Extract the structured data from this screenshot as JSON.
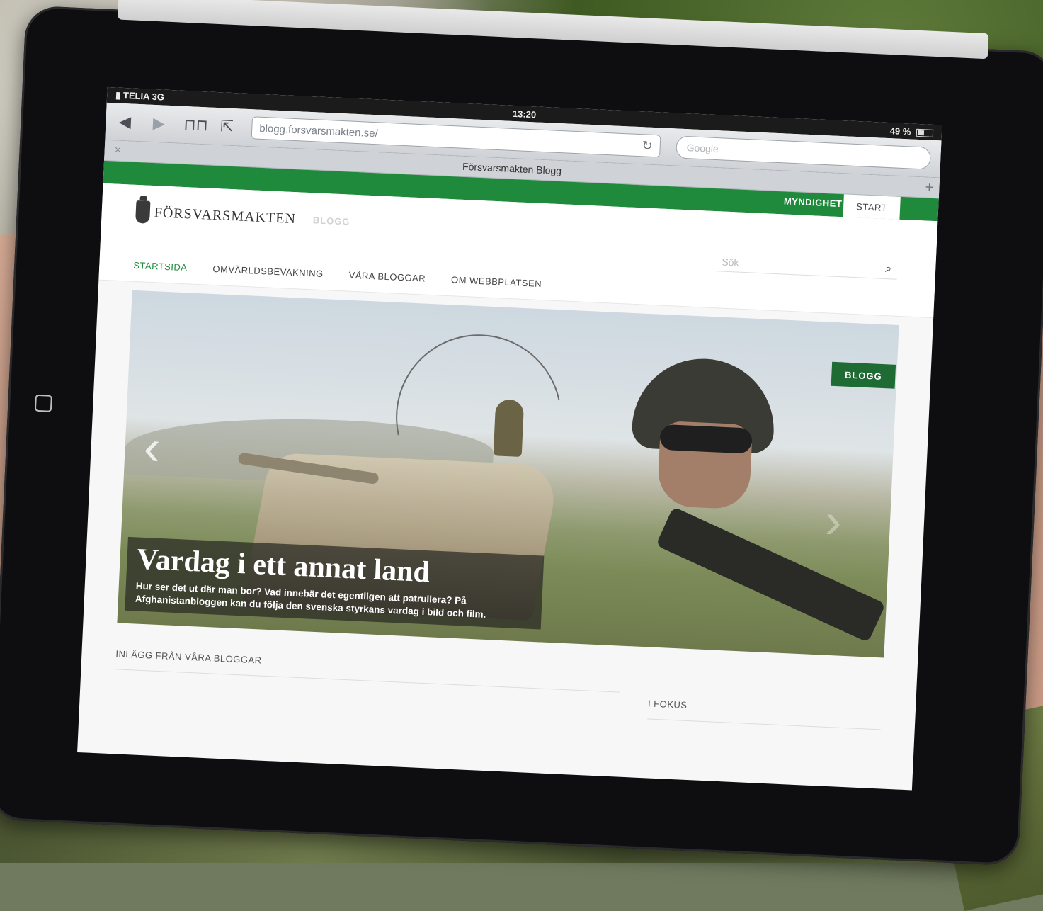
{
  "status_bar": {
    "carrier": "TELIA",
    "network": "3G",
    "time": "13:20",
    "battery": "49 %"
  },
  "safari": {
    "url": "blogg.forsvarsmakten.se/",
    "search_placeholder": "Google",
    "tab_title": "Försvarsmakten Blogg",
    "tab_close": "×",
    "tab_new": "+"
  },
  "site": {
    "topbar": {
      "myndighet": "MYNDIGHET",
      "start": "START"
    },
    "logo": {
      "name": "FÖRSVARSMAKTEN",
      "sub": "BLOGG"
    },
    "search_placeholder": "Sök",
    "nav": [
      {
        "label": "STARTSIDA",
        "active": true
      },
      {
        "label": "OMVÄRLDSBEVAKNING"
      },
      {
        "label": "VÅRA BLOGGAR"
      },
      {
        "label": "OM WEBBPLATSEN"
      }
    ],
    "hero": {
      "badge": "BLOGG",
      "title": "Vardag i ett annat land",
      "text": "Hur ser det ut där man bor? Vad innebär det egentligen att patrullera? På Afghanistanbloggen kan du följa den svenska styrkans vardag i bild och film."
    },
    "sections": {
      "posts": "INLÄGG FRÅN VÅRA BLOGGAR",
      "focus": "I FOKUS"
    }
  },
  "colors": {
    "brand_green": "#1f8a3c",
    "badge_green": "#1f6b34"
  }
}
